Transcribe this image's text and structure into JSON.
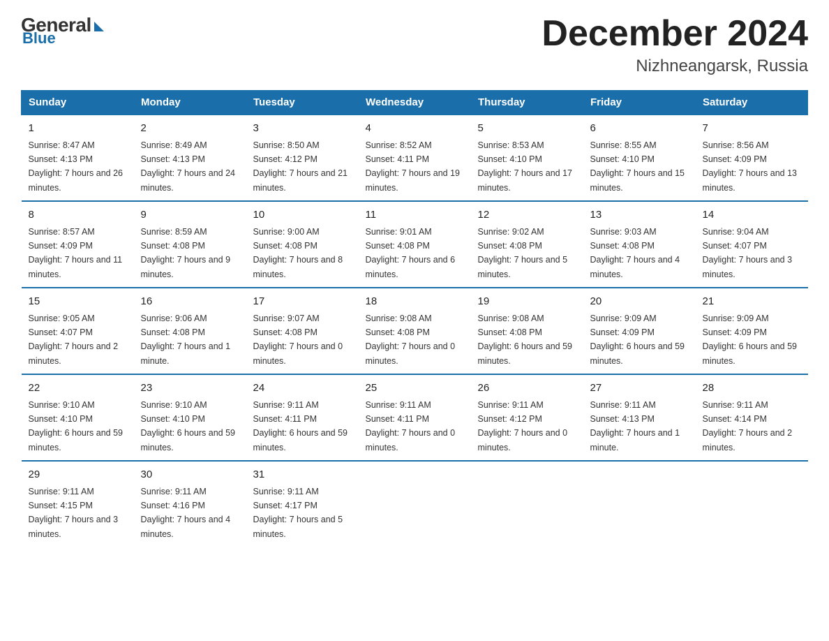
{
  "logo": {
    "general": "General",
    "blue": "Blue"
  },
  "title": {
    "month": "December 2024",
    "location": "Nizhneangarsk, Russia"
  },
  "days_header": [
    "Sunday",
    "Monday",
    "Tuesday",
    "Wednesday",
    "Thursday",
    "Friday",
    "Saturday"
  ],
  "weeks": [
    [
      {
        "day": "1",
        "sunrise": "8:47 AM",
        "sunset": "4:13 PM",
        "daylight": "7 hours and 26 minutes."
      },
      {
        "day": "2",
        "sunrise": "8:49 AM",
        "sunset": "4:13 PM",
        "daylight": "7 hours and 24 minutes."
      },
      {
        "day": "3",
        "sunrise": "8:50 AM",
        "sunset": "4:12 PM",
        "daylight": "7 hours and 21 minutes."
      },
      {
        "day": "4",
        "sunrise": "8:52 AM",
        "sunset": "4:11 PM",
        "daylight": "7 hours and 19 minutes."
      },
      {
        "day": "5",
        "sunrise": "8:53 AM",
        "sunset": "4:10 PM",
        "daylight": "7 hours and 17 minutes."
      },
      {
        "day": "6",
        "sunrise": "8:55 AM",
        "sunset": "4:10 PM",
        "daylight": "7 hours and 15 minutes."
      },
      {
        "day": "7",
        "sunrise": "8:56 AM",
        "sunset": "4:09 PM",
        "daylight": "7 hours and 13 minutes."
      }
    ],
    [
      {
        "day": "8",
        "sunrise": "8:57 AM",
        "sunset": "4:09 PM",
        "daylight": "7 hours and 11 minutes."
      },
      {
        "day": "9",
        "sunrise": "8:59 AM",
        "sunset": "4:08 PM",
        "daylight": "7 hours and 9 minutes."
      },
      {
        "day": "10",
        "sunrise": "9:00 AM",
        "sunset": "4:08 PM",
        "daylight": "7 hours and 8 minutes."
      },
      {
        "day": "11",
        "sunrise": "9:01 AM",
        "sunset": "4:08 PM",
        "daylight": "7 hours and 6 minutes."
      },
      {
        "day": "12",
        "sunrise": "9:02 AM",
        "sunset": "4:08 PM",
        "daylight": "7 hours and 5 minutes."
      },
      {
        "day": "13",
        "sunrise": "9:03 AM",
        "sunset": "4:08 PM",
        "daylight": "7 hours and 4 minutes."
      },
      {
        "day": "14",
        "sunrise": "9:04 AM",
        "sunset": "4:07 PM",
        "daylight": "7 hours and 3 minutes."
      }
    ],
    [
      {
        "day": "15",
        "sunrise": "9:05 AM",
        "sunset": "4:07 PM",
        "daylight": "7 hours and 2 minutes."
      },
      {
        "day": "16",
        "sunrise": "9:06 AM",
        "sunset": "4:08 PM",
        "daylight": "7 hours and 1 minute."
      },
      {
        "day": "17",
        "sunrise": "9:07 AM",
        "sunset": "4:08 PM",
        "daylight": "7 hours and 0 minutes."
      },
      {
        "day": "18",
        "sunrise": "9:08 AM",
        "sunset": "4:08 PM",
        "daylight": "7 hours and 0 minutes."
      },
      {
        "day": "19",
        "sunrise": "9:08 AM",
        "sunset": "4:08 PM",
        "daylight": "6 hours and 59 minutes."
      },
      {
        "day": "20",
        "sunrise": "9:09 AM",
        "sunset": "4:09 PM",
        "daylight": "6 hours and 59 minutes."
      },
      {
        "day": "21",
        "sunrise": "9:09 AM",
        "sunset": "4:09 PM",
        "daylight": "6 hours and 59 minutes."
      }
    ],
    [
      {
        "day": "22",
        "sunrise": "9:10 AM",
        "sunset": "4:10 PM",
        "daylight": "6 hours and 59 minutes."
      },
      {
        "day": "23",
        "sunrise": "9:10 AM",
        "sunset": "4:10 PM",
        "daylight": "6 hours and 59 minutes."
      },
      {
        "day": "24",
        "sunrise": "9:11 AM",
        "sunset": "4:11 PM",
        "daylight": "6 hours and 59 minutes."
      },
      {
        "day": "25",
        "sunrise": "9:11 AM",
        "sunset": "4:11 PM",
        "daylight": "7 hours and 0 minutes."
      },
      {
        "day": "26",
        "sunrise": "9:11 AM",
        "sunset": "4:12 PM",
        "daylight": "7 hours and 0 minutes."
      },
      {
        "day": "27",
        "sunrise": "9:11 AM",
        "sunset": "4:13 PM",
        "daylight": "7 hours and 1 minute."
      },
      {
        "day": "28",
        "sunrise": "9:11 AM",
        "sunset": "4:14 PM",
        "daylight": "7 hours and 2 minutes."
      }
    ],
    [
      {
        "day": "29",
        "sunrise": "9:11 AM",
        "sunset": "4:15 PM",
        "daylight": "7 hours and 3 minutes."
      },
      {
        "day": "30",
        "sunrise": "9:11 AM",
        "sunset": "4:16 PM",
        "daylight": "7 hours and 4 minutes."
      },
      {
        "day": "31",
        "sunrise": "9:11 AM",
        "sunset": "4:17 PM",
        "daylight": "7 hours and 5 minutes."
      },
      null,
      null,
      null,
      null
    ]
  ]
}
